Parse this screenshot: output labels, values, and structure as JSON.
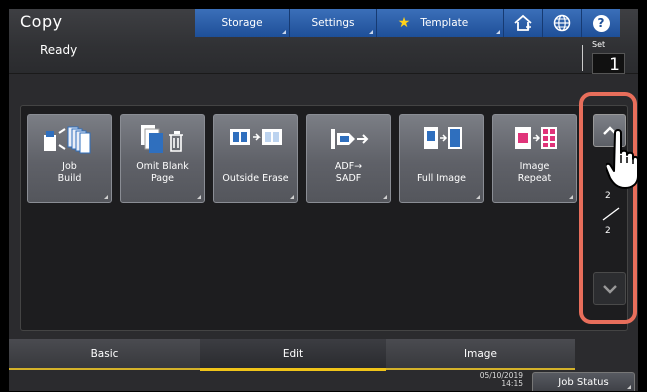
{
  "app": {
    "title": "Copy"
  },
  "topbar": {
    "storage": "Storage",
    "settings": "Settings",
    "template": "Template",
    "icons": [
      "home-icon",
      "globe-icon",
      "help-icon"
    ],
    "help_glyph": "?"
  },
  "status": {
    "text": "Ready"
  },
  "set": {
    "label": "Set",
    "value": "1"
  },
  "functions": [
    {
      "label": "Job\nBuild",
      "icon": "job-build-icon"
    },
    {
      "label": "Omit Blank\nPage",
      "icon": "omit-blank-page-icon"
    },
    {
      "label": "Outside Erase",
      "icon": "outside-erase-icon"
    },
    {
      "label": "ADF→\nSADF",
      "icon": "adf-sadf-icon"
    },
    {
      "label": "Full Image",
      "icon": "full-image-icon"
    },
    {
      "label": "Image\nRepeat",
      "icon": "image-repeat-icon"
    }
  ],
  "pager": {
    "current": "2",
    "total": "2"
  },
  "tabs": [
    {
      "label": "Basic"
    },
    {
      "label": "Edit",
      "selected": true
    },
    {
      "label": "Image"
    }
  ],
  "footer": {
    "date": "05/10/2019",
    "time": "14:15",
    "job_status": "Job Status"
  },
  "colors": {
    "accent": "#1e4f98",
    "highlight": "#e86e5b",
    "tab_underline": "#f0c419"
  }
}
